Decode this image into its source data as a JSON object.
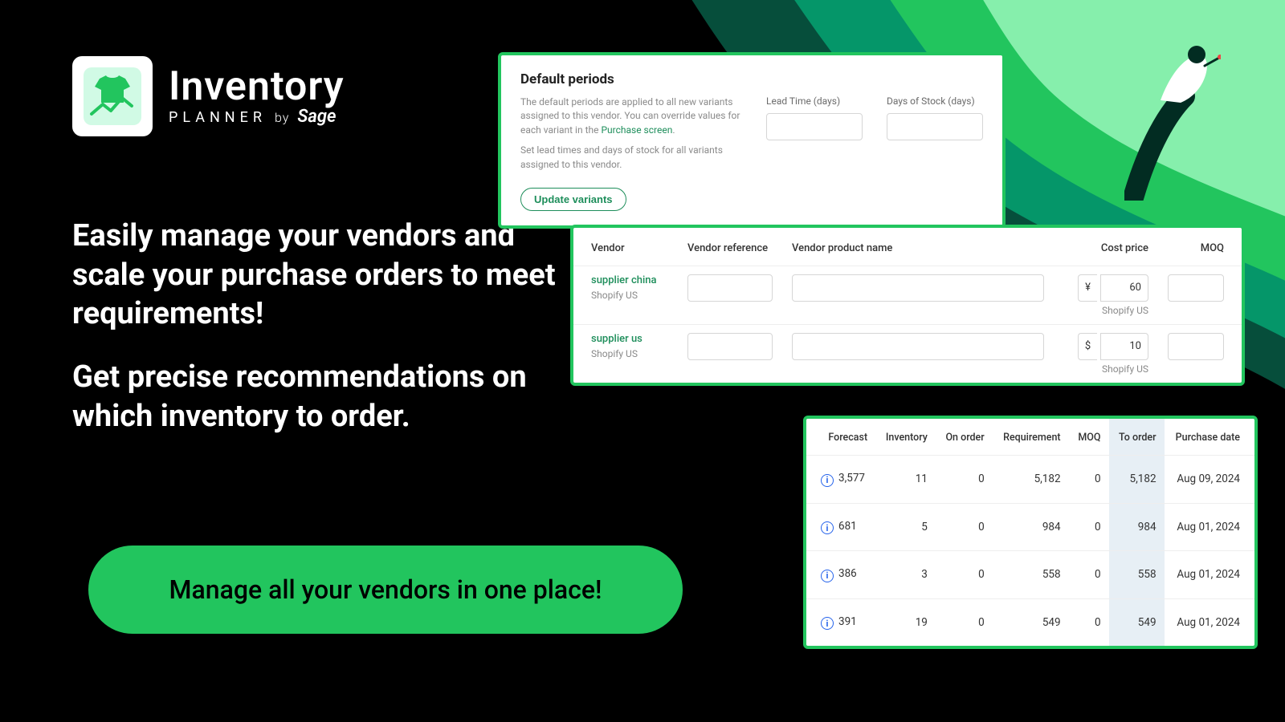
{
  "brand": {
    "name": "Inventory",
    "tagline_planner": "PLANNER",
    "tagline_by": "by",
    "tagline_sage": "Sage"
  },
  "hero": {
    "p1": "Easily manage your vendors and scale your purchase orders to meet requirements!",
    "p2": "Get precise recommendations on which inventory to order."
  },
  "cta": {
    "label": "Manage all your vendors in one place!"
  },
  "defaultPeriods": {
    "title": "Default periods",
    "desc1a": "The default periods are applied to all new variants assigned to this vendor. You can override values for each variant in the ",
    "desc1_link": "Purchase screen",
    "desc1b": ".",
    "desc2": "Set lead times and days of stock for all variants assigned to this vendor.",
    "leadTimeLabel": "Lead Time (days)",
    "daysStockLabel": "Days of Stock (days)",
    "updateBtn": "Update variants"
  },
  "vendorsTable": {
    "headers": {
      "vendor": "Vendor",
      "vendorRef": "Vendor reference",
      "vendorProdName": "Vendor product name",
      "costPrice": "Cost price",
      "moq": "MOQ"
    },
    "rows": [
      {
        "name": "supplier china",
        "sub": "Shopify US",
        "currency": "¥",
        "amount": "60",
        "costSub": "Shopify US"
      },
      {
        "name": "supplier us",
        "sub": "Shopify US",
        "currency": "$",
        "amount": "10",
        "costSub": "Shopify US"
      }
    ]
  },
  "forecastTable": {
    "headers": {
      "forecast": "Forecast",
      "inventory": "Inventory",
      "onOrder": "On order",
      "requirement": "Requirement",
      "moq": "MOQ",
      "toOrder": "To order",
      "purchaseDate": "Purchase date"
    },
    "rows": [
      {
        "forecast": "3,577",
        "inventory": "11",
        "onOrder": "0",
        "requirement": "5,182",
        "moq": "0",
        "toOrder": "5,182",
        "purchaseDate": "Aug 09, 2024"
      },
      {
        "forecast": "681",
        "inventory": "5",
        "onOrder": "0",
        "requirement": "984",
        "moq": "0",
        "toOrder": "984",
        "purchaseDate": "Aug 01, 2024"
      },
      {
        "forecast": "386",
        "inventory": "3",
        "onOrder": "0",
        "requirement": "558",
        "moq": "0",
        "toOrder": "558",
        "purchaseDate": "Aug 01, 2024"
      },
      {
        "forecast": "391",
        "inventory": "19",
        "onOrder": "0",
        "requirement": "549",
        "moq": "0",
        "toOrder": "549",
        "purchaseDate": "Aug 01, 2024"
      }
    ]
  }
}
